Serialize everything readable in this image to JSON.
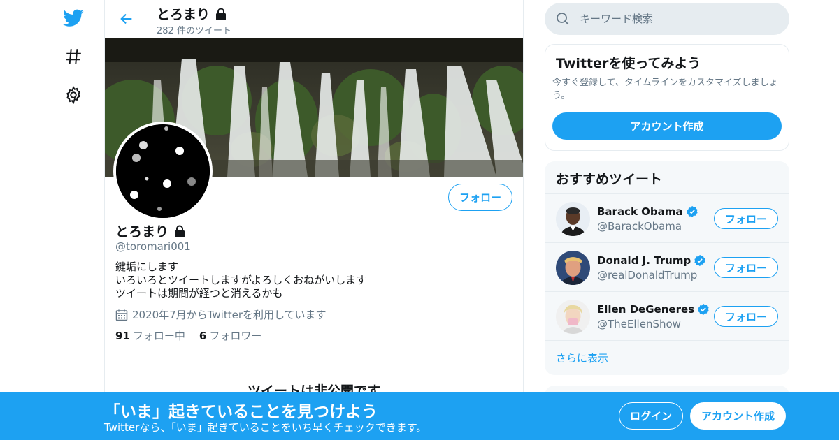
{
  "colors": {
    "accent": "#1da1f2",
    "text": "#14171a",
    "secondary": "#657786",
    "border": "#e6ecf0",
    "card_bg": "#f5f8fa"
  },
  "nav": {
    "icons": [
      "twitter-logo-icon",
      "hashtag-icon",
      "gear-icon"
    ]
  },
  "profile_header": {
    "name": "とろまり",
    "tweet_count": "282 件のツイート",
    "lock_icon": "lock-icon",
    "back_icon": "arrow-left-icon"
  },
  "profile": {
    "name": "とろまり",
    "handle": "@toromari001",
    "bio": [
      "鍵垢にします",
      "いろいろとツイートしますがよろしくおねがいします",
      "ツイートは期間が経つと消えるかも"
    ],
    "joined": "2020年7月からTwitterを利用しています",
    "following_count": "91",
    "following_label": "フォロー中",
    "followers_count": "6",
    "followers_label": "フォロワー",
    "follow_label": "フォロー",
    "protected_title": "ツイートは非公開です"
  },
  "search": {
    "placeholder": "キーワード検索",
    "icon": "search-icon"
  },
  "signup_card": {
    "title": "Twitterを使ってみよう",
    "description": "今すぐ登録して、タイムラインをカスタマイズしましょう。",
    "button": "アカウント作成"
  },
  "recommendations": {
    "title": "おすすめツイート",
    "users": [
      {
        "name": "Barack Obama",
        "handle": "@BarackObama",
        "verified": true,
        "follow_label": "フォロー"
      },
      {
        "name": "Donald J. Trump",
        "handle": "@realDonaldTrump",
        "verified": true,
        "follow_label": "フォロー"
      },
      {
        "name": "Ellen DeGeneres",
        "handle": "@TheEllenShow",
        "verified": true,
        "follow_label": "フォロー"
      }
    ],
    "more": "さらに表示"
  },
  "bottom_bar": {
    "title": "「いま」起きていることを見つけよう",
    "subtitle": "Twitterなら、「いま」起きていることをいち早くチェックできます。",
    "login": "ログイン",
    "signup": "アカウント作成"
  }
}
